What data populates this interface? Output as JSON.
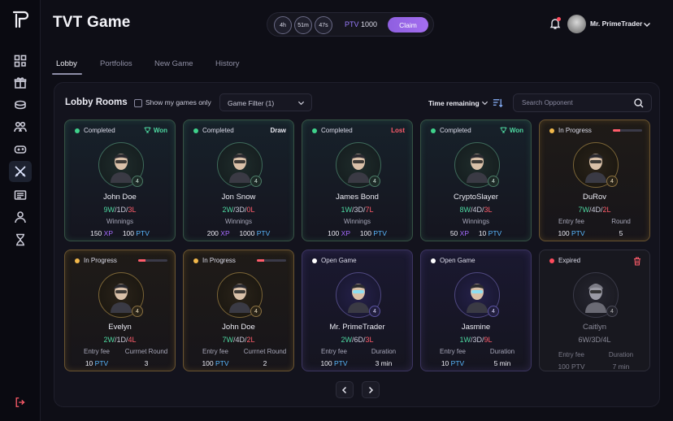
{
  "app": {
    "title": "TVT Game"
  },
  "timer": {
    "hours": "4h",
    "minutes": "51m",
    "seconds": "47s",
    "ptv_label": "PTV",
    "ptv_value": "1000",
    "claim_label": "Claim"
  },
  "user": {
    "name": "Mr. PrimeTrader"
  },
  "tabs": [
    {
      "label": "Lobby",
      "active": true
    },
    {
      "label": "Portfolios"
    },
    {
      "label": "New Game"
    },
    {
      "label": "History"
    }
  ],
  "lobby": {
    "title": "Lobby Rooms",
    "show_mine_label": "Show my games only",
    "filter_label": "Game Filter (1)",
    "sort_label": "Time remaining",
    "search_placeholder": "Search Opponent"
  },
  "currency": {
    "xp": "XP",
    "ptv": "PTV"
  },
  "cards": [
    {
      "status": "Completed",
      "status_color": "#3fd28b",
      "result": "Won",
      "name": "John Doe",
      "level": "4",
      "w": "9W",
      "d": "1D",
      "l": "3L",
      "label1": "Winnings",
      "xp": "150",
      "ptv": "100",
      "variant": "green"
    },
    {
      "status": "Completed",
      "status_color": "#3fd28b",
      "result": "Draw",
      "name": "Jon Snow",
      "level": "4",
      "w": "2W",
      "d": "3D",
      "l": "0L",
      "label1": "Winnings",
      "xp": "200",
      "ptv": "1000",
      "variant": "green"
    },
    {
      "status": "Completed",
      "status_color": "#3fd28b",
      "result": "Lost",
      "name": "James Bond",
      "level": "4",
      "w": "1W",
      "d": "3D",
      "l": "7L",
      "label1": "Winnings",
      "xp": "100",
      "ptv": "100",
      "variant": "green"
    },
    {
      "status": "Completed",
      "status_color": "#3fd28b",
      "result": "Won",
      "name": "CryptoSlayer",
      "level": "4",
      "w": "8W",
      "d": "4D",
      "l": "3L",
      "label1": "Winnings",
      "xp": "50",
      "ptv": "10",
      "variant": "green"
    },
    {
      "status": "In Progress",
      "status_color": "#f2b84b",
      "name": "DuRov",
      "level": "4",
      "w": "7W",
      "d": "4D",
      "l": "2L",
      "label1": "Entry fee",
      "label2": "Round",
      "fee": "100",
      "value2": "5",
      "variant": "orange",
      "progress": 0.25
    },
    {
      "status": "In Progress",
      "status_color": "#f2b84b",
      "name": "Evelyn",
      "level": "4",
      "w": "2W",
      "d": "1D",
      "l": "4L",
      "label1": "Entry fee",
      "label2": "Currnet Round",
      "fee": "10",
      "value2": "3",
      "variant": "orange",
      "progress": 0.25
    },
    {
      "status": "In Progress",
      "status_color": "#f2b84b",
      "name": "John Doe",
      "level": "4",
      "w": "7W",
      "d": "4D",
      "l": "2L",
      "label1": "Entry fee",
      "label2": "Currnet Round",
      "fee": "100",
      "value2": "2",
      "variant": "orange",
      "progress": 0.25
    },
    {
      "status": "Open Game",
      "status_color": "#ffffff",
      "name": "Mr. PrimeTrader",
      "level": "4",
      "w": "2W",
      "d": "6D",
      "l": "3L",
      "label1": "Entry fee",
      "label2": "Duration",
      "fee": "100",
      "value2": "3 min",
      "variant": "purple"
    },
    {
      "status": "Open Game",
      "status_color": "#ffffff",
      "name": "Jasmine",
      "level": "4",
      "w": "1W",
      "d": "3D",
      "l": "9L",
      "label1": "Entry fee",
      "label2": "Duration",
      "fee": "10",
      "value2": "5 min",
      "variant": "purple"
    },
    {
      "status": "Expired",
      "status_color": "#ff4b5c",
      "name": "Caitlyn",
      "level": "4",
      "w": "6W",
      "d": "3D",
      "l": "4L",
      "label1": "Entry fee",
      "label2": "Duration",
      "fee": "100 PTV",
      "value2": "7 min",
      "variant": "gray"
    }
  ]
}
